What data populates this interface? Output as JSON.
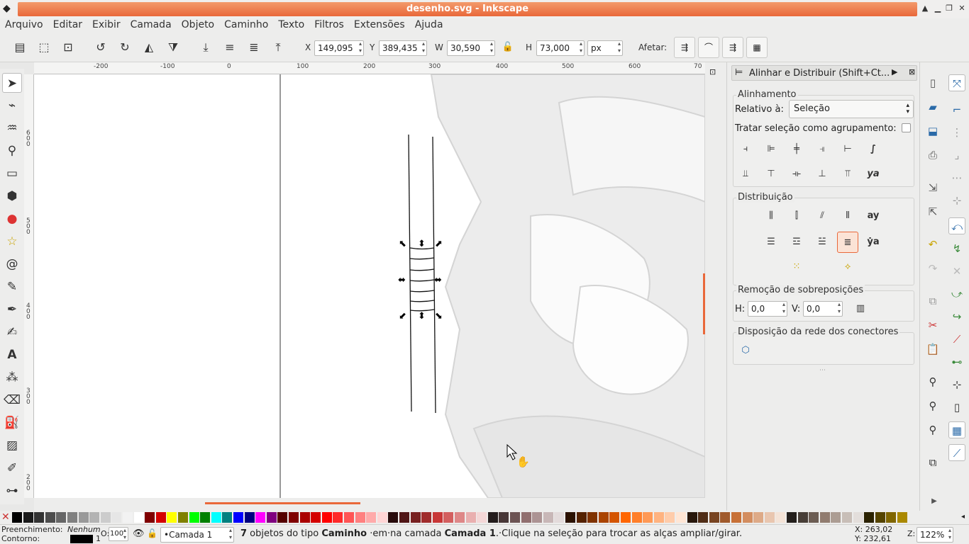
{
  "window": {
    "title": "desenho.svg - Inkscape"
  },
  "menu": [
    "Arquivo",
    "Editar",
    "Exibir",
    "Camada",
    "Objeto",
    "Caminho",
    "Texto",
    "Filtros",
    "Extensões",
    "Ajuda"
  ],
  "toolbar": {
    "x_label": "X",
    "x_value": "149,095",
    "y_label": "Y",
    "y_value": "389,435",
    "w_label": "W",
    "w_value": "30,590",
    "h_label": "H",
    "h_value": "73,000",
    "unit": "px",
    "affect_label": "Afetar:"
  },
  "ruler": {
    "h_ticks": [
      "-200",
      "-100",
      "0",
      "100",
      "200",
      "300",
      "400",
      "500",
      "600",
      "70"
    ],
    "v_ticks": [
      "6",
      "0",
      "0",
      "5",
      "0",
      "0",
      "4",
      "0",
      "0",
      "3",
      "0",
      "0",
      "2",
      "0",
      "0"
    ]
  },
  "dock": {
    "title": "Alinhar e Distribuir (Shift+Ct...",
    "align_section": "Alinhamento",
    "relative_label": "Relativo à:",
    "relative_value": "Seleção",
    "group_label": "Tratar seleção como agrupamento:",
    "distribute_section": "Distribuição",
    "overlap_section": "Remoção de sobreposições",
    "h_label": "H:",
    "h_value": "0,0",
    "v_label": "V:",
    "v_value": "0,0",
    "connector_section": "Disposição da rede dos conectores"
  },
  "status": {
    "fill_label": "Preenchimento:",
    "fill_value": "Nenhum",
    "stroke_label": "Contorno:",
    "stroke_width": "1",
    "opacity_label": "O:",
    "opacity_value": "100",
    "layer": "•Camada 1",
    "message_count": "7",
    "message_pre": " objetos do tipo ",
    "message_type": "Caminho",
    "message_mid": " ·em·na camada ",
    "message_layer": "Camada 1",
    "message_post": ".·Clique na seleção para trocar as alças ampliar/girar.",
    "cursor_x": "X: 263,02",
    "cursor_y": "Y: 232,61",
    "zoom_label": "Z:",
    "zoom_value": "122%"
  },
  "colors": {
    "accent": "#e9683a",
    "palette": [
      "#000000",
      "#1a1a1a",
      "#333333",
      "#4d4d4d",
      "#666666",
      "#808080",
      "#999999",
      "#b3b3b3",
      "#cccccc",
      "#e6e6e6",
      "#f2f2f2",
      "#ffffff",
      "#800000",
      "#d40000",
      "#ffff00",
      "#808000",
      "#00ff00",
      "#008000",
      "#00ffff",
      "#008080",
      "#0000ff",
      "#000080",
      "#ff00ff",
      "#800080",
      "#550000",
      "#800000",
      "#aa0000",
      "#d40000",
      "#ff0000",
      "#ff2a2a",
      "#ff5555",
      "#ff8080",
      "#ffaaaa",
      "#ffd5d5",
      "#280b0b",
      "#501616",
      "#782121",
      "#a02c2c",
      "#c83737",
      "#d35f5f",
      "#de8787",
      "#e9afaf",
      "#f4d7d7",
      "#241c1c",
      "#483737",
      "#6c5353",
      "#916f6f",
      "#ac9393",
      "#c8b7b7",
      "#e3dbdb",
      "#2b1100",
      "#552200",
      "#803300",
      "#aa4400",
      "#d45500",
      "#ff6600",
      "#ff7f2a",
      "#ff9955",
      "#ffb380",
      "#ffccaa",
      "#ffe6d5",
      "#28170b",
      "#502d16",
      "#784421",
      "#a05a2c",
      "#c87137",
      "#d38d5f",
      "#deaa87",
      "#e9c6af",
      "#f4e3d7",
      "#241f1c",
      "#483e37",
      "#6c5d53",
      "#917c6f",
      "#ac9d93",
      "#c8beb7",
      "#e3dedb",
      "#2b2200",
      "#554400",
      "#806600",
      "#aa8800"
    ]
  }
}
